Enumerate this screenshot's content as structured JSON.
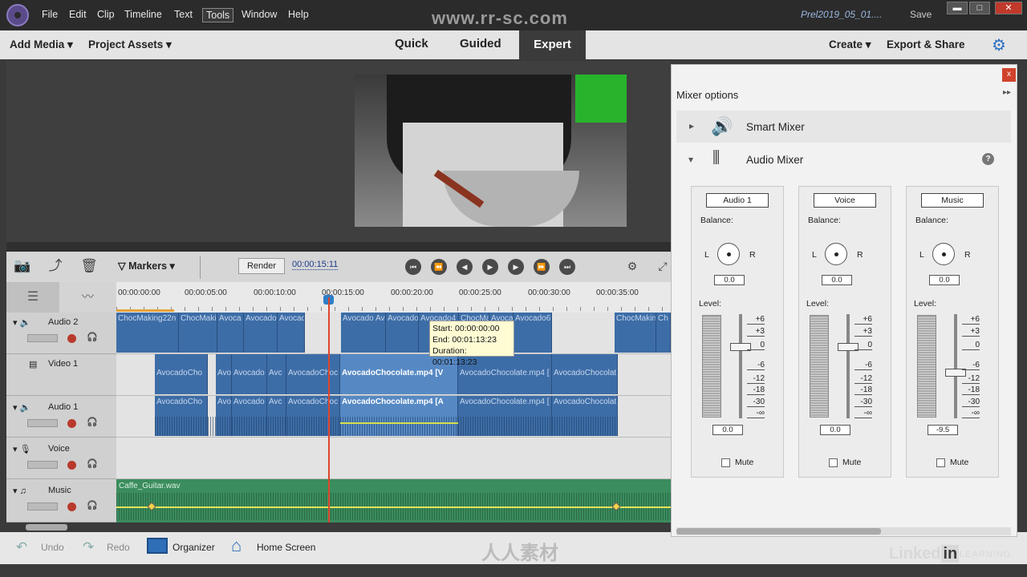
{
  "menubar": {
    "items": [
      "File",
      "Edit",
      "Clip",
      "Timeline",
      "Text",
      "Tools",
      "Window",
      "Help"
    ],
    "active": "Tools",
    "project_name": "Prel2019_05_01....",
    "save_label": "Save"
  },
  "watermark": "www.rr-sc.com",
  "modebar": {
    "add_media": "Add Media",
    "project_assets": "Project Assets",
    "modes": [
      "Quick",
      "Guided",
      "Expert"
    ],
    "active_mode": "Expert",
    "create": "Create",
    "export_share": "Export & Share"
  },
  "timeline_toolbar": {
    "markers": "Markers",
    "render": "Render",
    "timecode": "00:00:15:11"
  },
  "ruler": {
    "ticks": [
      "00:00:00:00",
      "00:00:05:00",
      "00:00:10:00",
      "00:00:15:00",
      "00:00:20:00",
      "00:00:25:00",
      "00:00:30:00",
      "00:00:35:00"
    ]
  },
  "tracks": [
    {
      "name": "Audio 2",
      "type": "audio"
    },
    {
      "name": "Video 1",
      "type": "video"
    },
    {
      "name": "Audio 1",
      "type": "audio"
    },
    {
      "name": "Voice",
      "type": "voice"
    },
    {
      "name": "Music",
      "type": "music"
    }
  ],
  "clips": {
    "audio2": [
      "ChocMaking22n",
      "ChocMaki",
      "Avoca",
      "Avocado",
      "Avocado",
      "Avocado Av",
      "AvocadoC",
      "Avocado4",
      "ChocMa",
      "Avoca",
      "Avocado6",
      "ChocMakin",
      "Ch"
    ],
    "video1": [
      "AvocadoCho",
      "Avo",
      "Avocado",
      "Avc",
      "AvocadoChoc",
      "AvocadoChocolate.mp4 [V",
      "AvocadoChocolate.mp4 [",
      "AvocadoChocolat"
    ],
    "audio1": [
      "AvocadoCho",
      "Avo",
      "Avocado",
      "Avc",
      "AvocadoChoc",
      "AvocadoChocolate.mp4 [A",
      "AvocadoChocolate.mp4 [",
      "AvocadoChocolat"
    ],
    "music": "Caffe_Guitar.wav"
  },
  "tooltip": {
    "start": "Start: 00:00:00:00",
    "end": "End: 00:01:13:23",
    "duration": "Duration: 00:01:13:23"
  },
  "bottombar": {
    "undo": "Undo",
    "redo": "Redo",
    "organizer": "Organizer",
    "home_screen": "Home Screen"
  },
  "brand": {
    "linkedin": "Linked",
    "linkedin_in": "in",
    "learning": "LEARNING",
    "site_mark": "人人素材"
  },
  "mixer": {
    "title": "Mixer options",
    "close": "x",
    "smart_mixer": "Smart Mixer",
    "audio_mixer": "Audio Mixer",
    "help": "?",
    "balance_label": "Balance:",
    "level_label": "Level:",
    "left": "L",
    "right": "R",
    "mute_label": "Mute",
    "scale": [
      "+6",
      "+3",
      "0",
      "-6",
      "-12",
      "-18",
      "-30",
      "-∞"
    ],
    "channels": [
      {
        "name": "Audio 1",
        "balance": "0.0",
        "level": "0.0",
        "level_db": 0
      },
      {
        "name": "Voice",
        "balance": "0.0",
        "level": "0.0",
        "level_db": 0
      },
      {
        "name": "Music",
        "balance": "0.0",
        "level": "-9.5",
        "level_db": -9.5
      }
    ]
  },
  "colors": {
    "accent": "#3b3b3b",
    "clip_blue": "#3d6da7",
    "clip_selected": "#5689c4",
    "music_green": "#3b8c5e",
    "playhead": "#e0452b"
  }
}
